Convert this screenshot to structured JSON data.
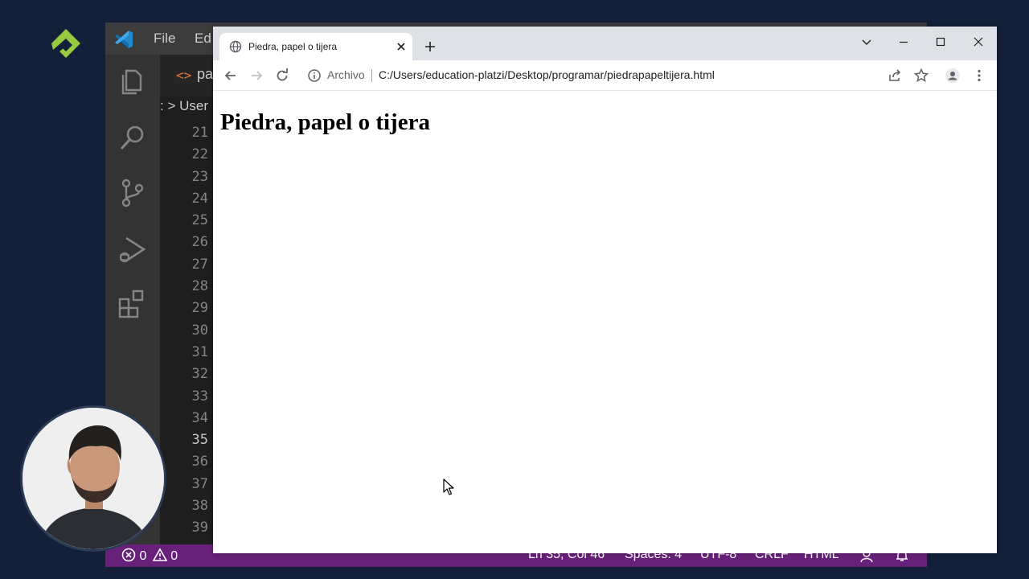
{
  "vscode": {
    "menu": [
      "File",
      "Ed"
    ],
    "tab_label": "pa",
    "tab_icon": "<>",
    "breadcrumb": ": > User",
    "line_numbers": [
      "21",
      "22",
      "23",
      "24",
      "25",
      "26",
      "27",
      "28",
      "29",
      "30",
      "31",
      "32",
      "33",
      "34",
      "35",
      "36",
      "37",
      "38",
      "39"
    ],
    "current_line": "35",
    "statusbar": {
      "errors": "0",
      "warnings": "0",
      "position": "Ln 35, Col 46",
      "spaces": "Spaces: 4",
      "encoding": "UTF-8",
      "eol": "CRLF",
      "language": "HTML"
    },
    "accent_color": "#68217a"
  },
  "chrome": {
    "tab_title": "Piedra, papel o tijera",
    "omnibox_chip": "Archivo",
    "url": "C:/Users/education-platzi/Desktop/programar/piedrapapeltijera.html"
  },
  "page": {
    "heading": "Piedra, papel o tijera"
  },
  "icons": [
    "platzi-logo",
    "vscode-logo",
    "files-icon",
    "search-icon",
    "source-control-icon",
    "run-debug-icon",
    "extensions-icon",
    "globe-icon",
    "close-icon",
    "new-tab-icon",
    "chevron-down-icon",
    "minimize-icon",
    "maximize-icon",
    "back-icon",
    "forward-icon",
    "reload-icon",
    "info-icon",
    "share-icon",
    "star-icon",
    "profile-icon",
    "menu-dots-icon",
    "error-icon",
    "warning-icon",
    "mouse-cursor-icon"
  ]
}
